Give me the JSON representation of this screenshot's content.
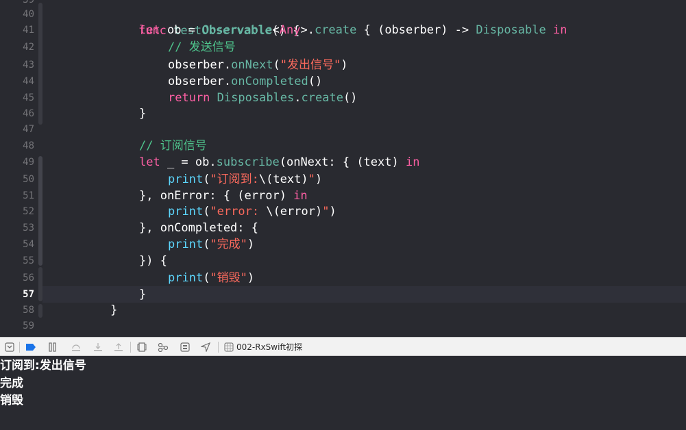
{
  "editor": {
    "top_partial_line": "39",
    "line_numbers": [
      "40",
      "41",
      "42",
      "43",
      "44",
      "45",
      "46",
      "47",
      "48",
      "49",
      "50",
      "51",
      "52",
      "53",
      "54",
      "55",
      "56",
      "57",
      "58",
      "59"
    ],
    "current_line": "57",
    "lines": {
      "l40": {
        "kw": "func",
        "name": "testObservable",
        "rest": "() {"
      },
      "l41": {
        "let": "let",
        "var": " ob = ",
        "type": "Observable",
        "lt": "<",
        "any": "Any",
        ">": ">.",
        "create": "create",
        " open": " { (obserber) -> ",
        "disp": "Disposable",
        "in": " in"
      },
      "l42": {
        "comment": "// 发送信号"
      },
      "l43": {
        "obj": "obserber.",
        "m": "onNext",
        "p1": "(",
        "s": "\"发出信号\"",
        "p2": ")"
      },
      "l44": {
        "obj": "obserber.",
        "m": "onCompleted",
        "p": "()"
      },
      "l45": {
        "ret": "return",
        "sp": " ",
        "t": "Disposables",
        "dot": ".",
        "m": "create",
        "p": "()"
      },
      "l46": {
        "t": "}"
      },
      "l48": {
        "comment": "// 订阅信号"
      },
      "l49": {
        "let": "let",
        "a": " _ = ob.",
        "m": "subscribe",
        "b": "(onNext: { (text) ",
        "in": "in"
      },
      "l50": {
        "pr": "print",
        "a": "(",
        "s1": "\"订阅到:",
        "interp": "\\(text)",
        "s2": "\"",
        ")": ")"
      },
      "l51": {
        "a": "}, onError: { (error) ",
        "in": "in"
      },
      "l52": {
        "pr": "print",
        "a": "(",
        "s1": "\"error: ",
        "interp": "\\(error)",
        "s2": "\"",
        ")": ")"
      },
      "l53": {
        "a": "}, onCompleted: {"
      },
      "l54": {
        "pr": "print",
        "a": "(",
        "s": "\"完成\"",
        ")": ")"
      },
      "l55": {
        "a": "}) {"
      },
      "l56": {
        "pr": "print",
        "a": "(",
        "s": "\"销毁\"",
        ")": ")"
      },
      "l57": {
        "a": "}"
      },
      "l58": {
        "a": "}"
      }
    }
  },
  "toolbar": {
    "target": "002-RxSwift初探"
  },
  "console": {
    "lines": [
      "订阅到:发出信号",
      "完成",
      "销毁"
    ]
  }
}
